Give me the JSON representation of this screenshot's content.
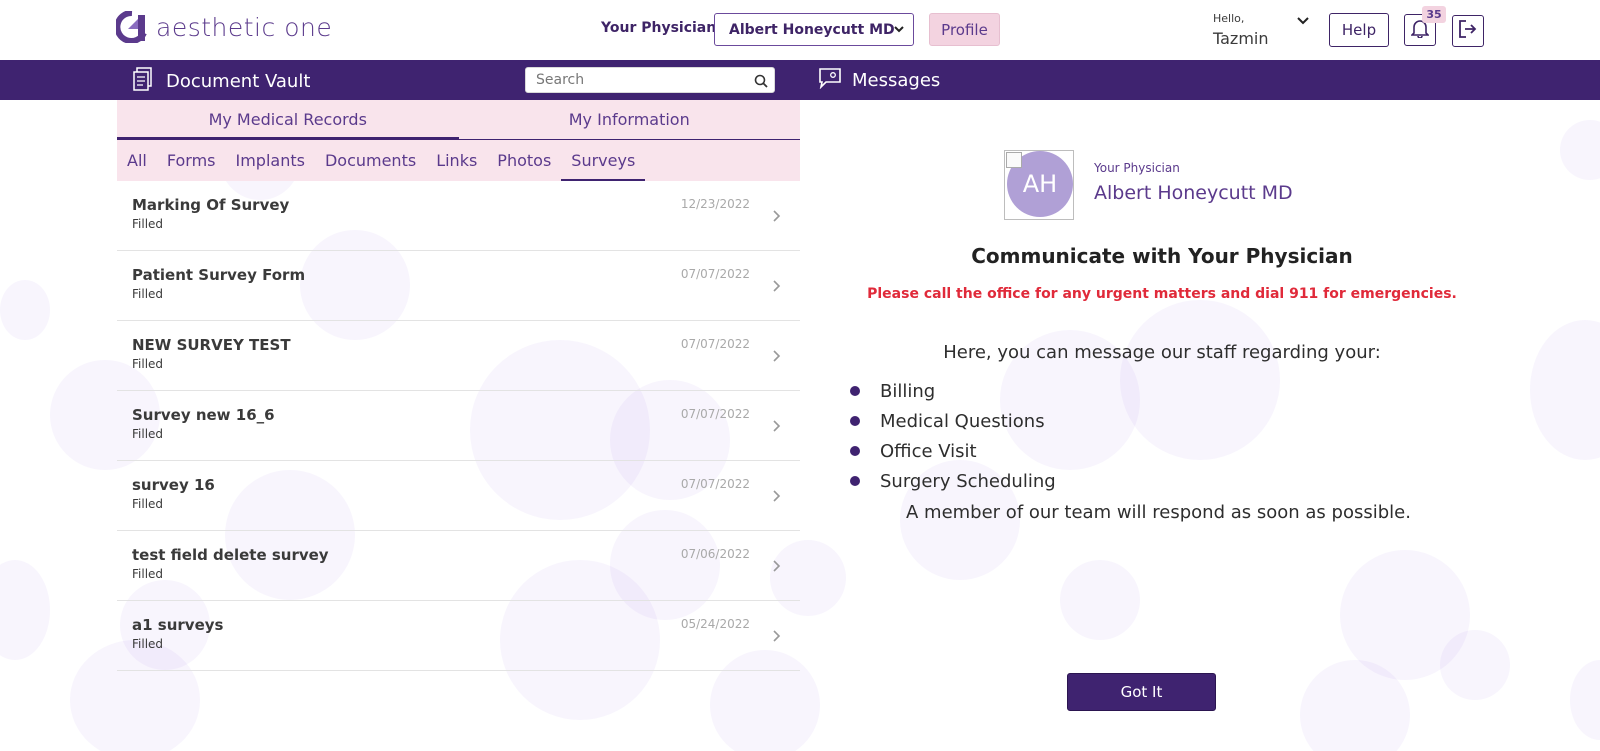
{
  "header": {
    "logo_text": "aesthetic one",
    "physician_label": "Your Physician",
    "physician_selected": "Albert Honeycutt MD",
    "profile_label": "Profile",
    "hello": "Hello,",
    "user_name": "Tazmin",
    "help_label": "Help",
    "notification_count": "35"
  },
  "navbar": {
    "vault_title": "Document Vault",
    "search_placeholder": "Search",
    "messages_title": "Messages"
  },
  "left": {
    "main_tabs": [
      {
        "label": "My Medical Records",
        "active": true
      },
      {
        "label": "My Information",
        "active": false
      }
    ],
    "sub_tabs": [
      {
        "label": "All"
      },
      {
        "label": "Forms"
      },
      {
        "label": "Implants"
      },
      {
        "label": "Documents"
      },
      {
        "label": "Links"
      },
      {
        "label": "Photos"
      },
      {
        "label": "Surveys",
        "active": true
      }
    ],
    "surveys": [
      {
        "title": "Marking Of Survey",
        "status": "Filled",
        "date": "12/23/2022"
      },
      {
        "title": "Patient Survey Form",
        "status": "Filled",
        "date": "07/07/2022"
      },
      {
        "title": "NEW SURVEY TEST",
        "status": "Filled",
        "date": "07/07/2022"
      },
      {
        "title": "Survey new 16_6",
        "status": "Filled",
        "date": "07/07/2022"
      },
      {
        "title": "survey 16",
        "status": "Filled",
        "date": "07/07/2022"
      },
      {
        "title": "test field delete survey",
        "status": "Filled",
        "date": "07/06/2022"
      },
      {
        "title": "a1 surveys",
        "status": "Filled",
        "date": "05/24/2022"
      }
    ]
  },
  "right": {
    "avatar_initials": "AH",
    "physician_small": "Your Physician",
    "physician_name": "Albert Honeycutt MD",
    "title": "Communicate with Your Physician",
    "urgent": "Please call the office for any urgent matters and dial 911 for emergencies.",
    "intro": "Here, you can message our staff regarding your:",
    "topics": [
      "Billing",
      "Medical Questions",
      "Office Visit",
      "Surgery Scheduling"
    ],
    "respond": "A member of our team will respond as soon as possible.",
    "button": "Got It"
  },
  "colors": {
    "brand_purple": "#3f2370",
    "pink_accent": "#f3d3e0",
    "urgent_red": "#e02a3a"
  }
}
